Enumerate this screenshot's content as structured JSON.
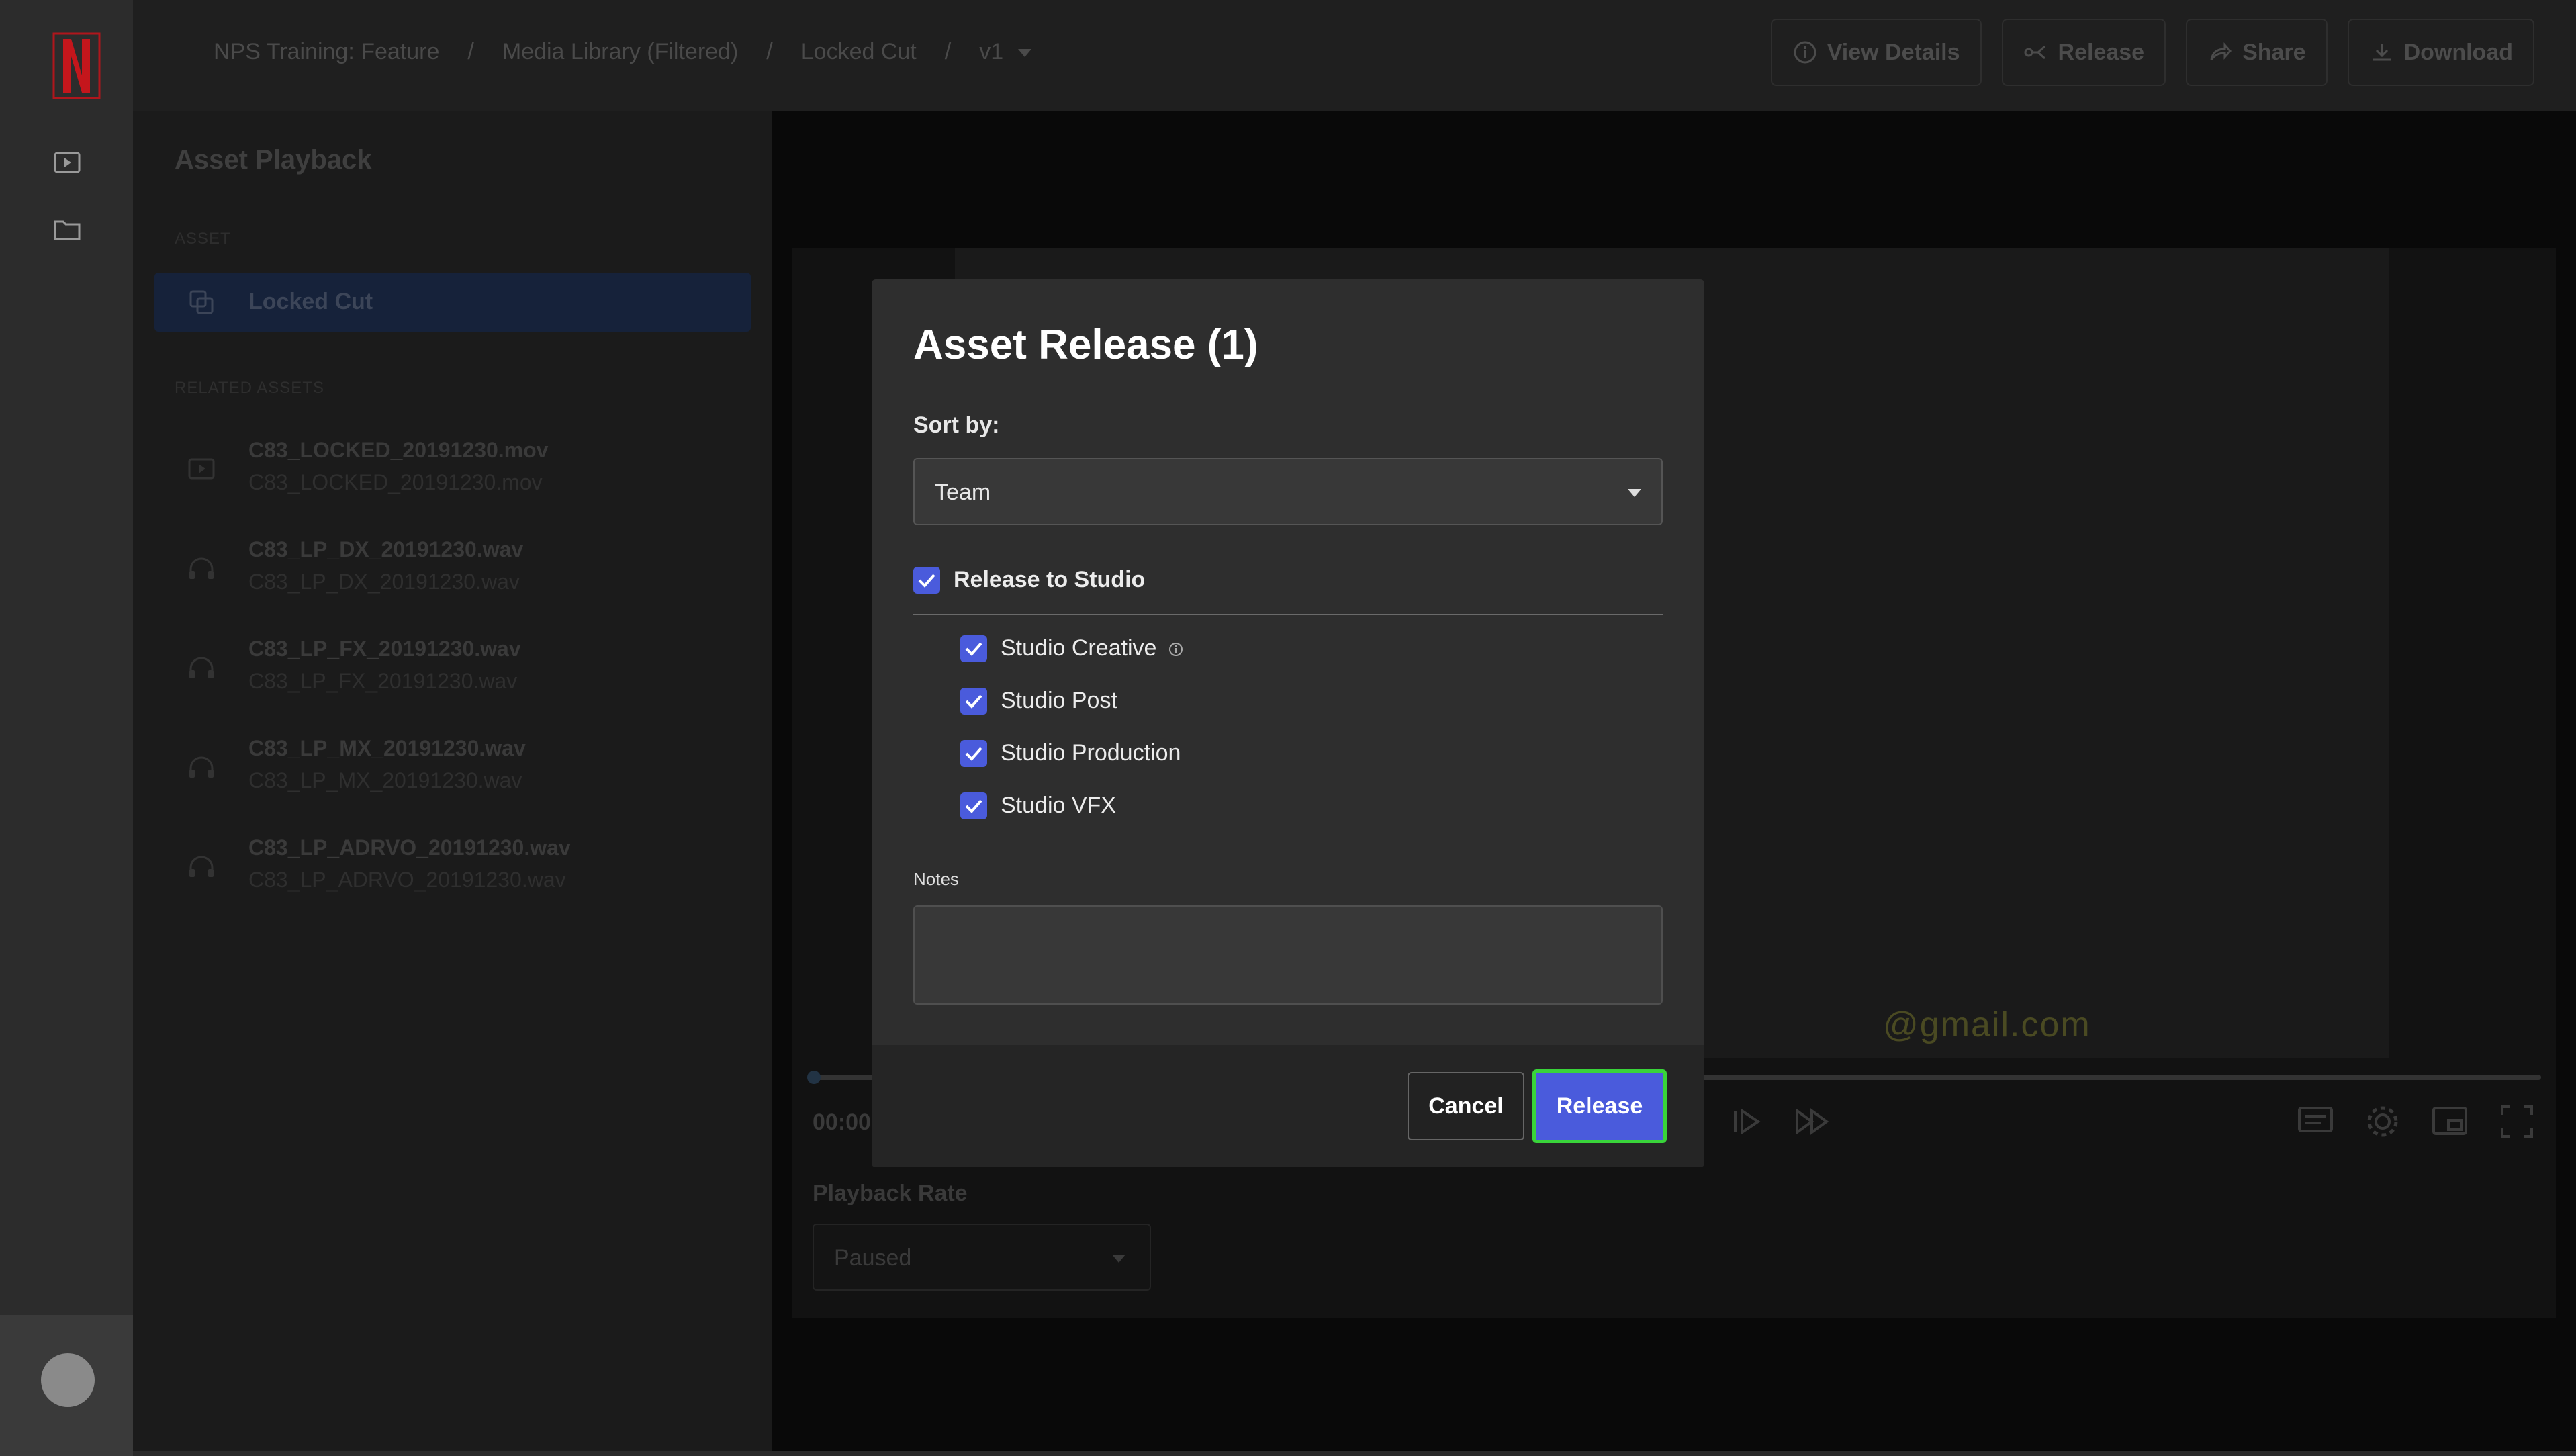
{
  "breadcrumb": [
    "NPS Training: Feature",
    "Media Library (Filtered)",
    "Locked Cut",
    "v1"
  ],
  "top_buttons": [
    {
      "label": "View Details",
      "icon": "info-icon"
    },
    {
      "label": "Release",
      "icon": "release-icon"
    },
    {
      "label": "Share",
      "icon": "share-icon"
    },
    {
      "label": "Download",
      "icon": "download-icon"
    }
  ],
  "sidebar": {
    "title": "Asset Playback",
    "asset_caption": "ASSET",
    "selected_asset": "Locked Cut",
    "related_caption": "RELATED ASSETS",
    "related": [
      {
        "name": "C83_LOCKED_20191230.mov",
        "file": "C83_LOCKED_20191230.mov",
        "icon": "video-icon"
      },
      {
        "name": "C83_LP_DX_20191230.wav",
        "file": "C83_LP_DX_20191230.wav",
        "icon": "headphones-icon"
      },
      {
        "name": "C83_LP_FX_20191230.wav",
        "file": "C83_LP_FX_20191230.wav",
        "icon": "headphones-icon"
      },
      {
        "name": "C83_LP_MX_20191230.wav",
        "file": "C83_LP_MX_20191230.wav",
        "icon": "headphones-icon"
      },
      {
        "name": "C83_LP_ADRVO_20191230.wav",
        "file": "C83_LP_ADRVO_20191230.wav",
        "icon": "headphones-icon"
      }
    ]
  },
  "player": {
    "watermark": "@gmail.com",
    "time": "00:00",
    "playback_rate_label": "Playback Rate",
    "playback_rate_value": "Paused"
  },
  "modal": {
    "title": "Asset Release (1)",
    "sort_label": "Sort by:",
    "sort_value": "Team",
    "release_to_studio": {
      "label": "Release to Studio",
      "checked": true
    },
    "teams": [
      {
        "label": "Studio Creative",
        "checked": true,
        "has_info": true
      },
      {
        "label": "Studio Post",
        "checked": true
      },
      {
        "label": "Studio Production",
        "checked": true
      },
      {
        "label": "Studio VFX",
        "checked": true
      }
    ],
    "notes_label": "Notes",
    "notes_value": "",
    "cancel_label": "Cancel",
    "release_label": "Release"
  },
  "colors": {
    "accent": "#4a5bdc",
    "focus_ring": "#39d43a",
    "brand_red": "#e50914"
  }
}
